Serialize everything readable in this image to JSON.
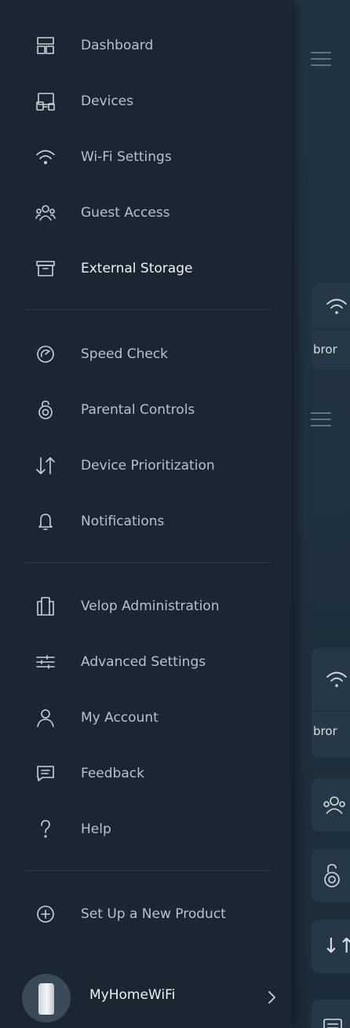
{
  "colors": {
    "drawer_bg": "#1a2632",
    "main_bg": "#213342",
    "card_bg": "#263847",
    "text_primary": "#eef2f5",
    "text_secondary": "#b8c2ca",
    "icon": "#c9d2d9"
  },
  "menu": {
    "group1": [
      {
        "label": "Dashboard",
        "icon": "dashboard-icon"
      },
      {
        "label": "Devices",
        "icon": "devices-icon"
      },
      {
        "label": "Wi-Fi Settings",
        "icon": "wifi-icon"
      },
      {
        "label": "Guest Access",
        "icon": "guest-icon"
      },
      {
        "label": "External Storage",
        "icon": "storage-icon"
      }
    ],
    "group2": [
      {
        "label": "Speed Check",
        "icon": "speedometer-icon"
      },
      {
        "label": "Parental Controls",
        "icon": "lock-icon"
      },
      {
        "label": "Device Prioritization",
        "icon": "priority-arrows-icon"
      },
      {
        "label": "Notifications",
        "icon": "bell-icon"
      }
    ],
    "group3": [
      {
        "label": "Velop Administration",
        "icon": "nodes-icon"
      },
      {
        "label": "Advanced Settings",
        "icon": "sliders-icon"
      },
      {
        "label": "My Account",
        "icon": "person-icon"
      },
      {
        "label": "Feedback",
        "icon": "chat-icon"
      },
      {
        "label": "Help",
        "icon": "question-icon"
      }
    ],
    "group4": [
      {
        "label": "Set Up a New Product",
        "icon": "plus-circle-icon"
      }
    ]
  },
  "network": {
    "name": "MyHomeWiFi"
  },
  "background": {
    "card1_label": "bror",
    "card2_label": "bror",
    "tile_priority_glyph": "↓↑"
  }
}
